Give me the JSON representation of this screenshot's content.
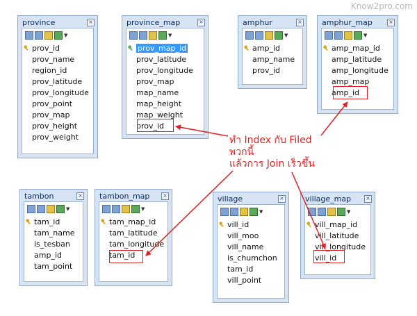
{
  "watermark": "Know2pro.com",
  "annotation": {
    "line1": "ทำ Index กับ Filed",
    "line2": "พวกนี้",
    "line3": "แล้วการ Join เร็วขึ้น"
  },
  "colors": {
    "accent": "#e02020",
    "table_bg": "#d6e3f3",
    "selection": "#3399ff"
  },
  "tables": {
    "province": {
      "title": "province",
      "fields": [
        "prov_id",
        "prov_name",
        "region_id",
        "prov_latitude",
        "prov_longitude",
        "prov_point",
        "prov_map",
        "prov_height",
        "prov_weight"
      ]
    },
    "province_map": {
      "title": "province_map",
      "fields": [
        "prov_map_id",
        "prov_latitude",
        "prov_longitude",
        "prov_map",
        "map_name",
        "map_height",
        "map_weight",
        "prov_id"
      ]
    },
    "amphur": {
      "title": "amphur",
      "fields": [
        "amp_id",
        "amp_name",
        "prov_id"
      ]
    },
    "amphur_map": {
      "title": "amphur_map",
      "fields": [
        "amp_map_id",
        "amp_latitude",
        "amp_longitude",
        "amp_map",
        "amp_id"
      ]
    },
    "tambon": {
      "title": "tambon",
      "fields": [
        "tam_id",
        "tam_name",
        "is_tesban",
        "amp_id",
        "tam_point"
      ]
    },
    "tambon_map": {
      "title": "tambon_map",
      "fields": [
        "tam_map_id",
        "tam_latitude",
        "tam_longitude",
        "tam_id"
      ]
    },
    "village": {
      "title": "village",
      "fields": [
        "vill_id",
        "vill_moo",
        "vill_name",
        "is_chumchon",
        "tam_id",
        "vill_point"
      ]
    },
    "village_map": {
      "title": "village_map",
      "fields": [
        "vill_map_id",
        "vill_latitude",
        "vill_longitude",
        "vill_id"
      ]
    }
  }
}
